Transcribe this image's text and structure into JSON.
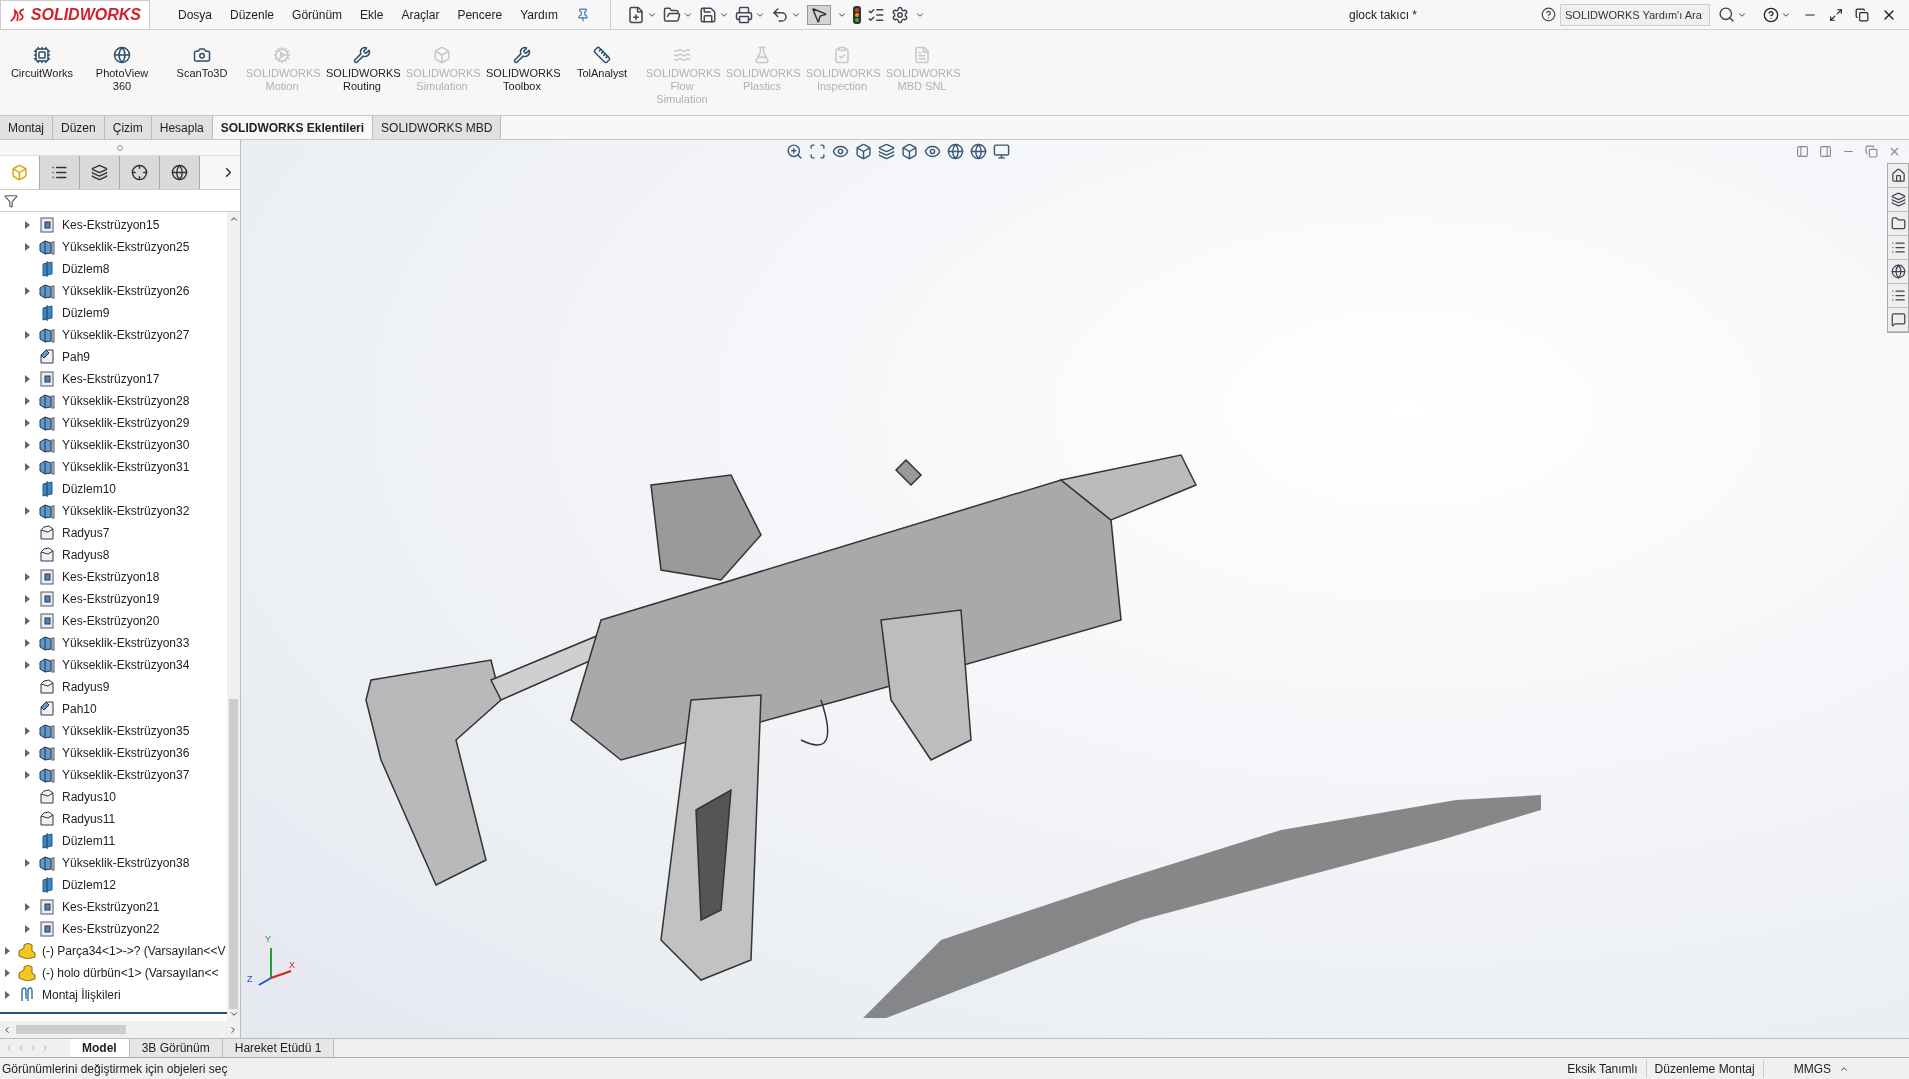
{
  "app": {
    "logo": "SOLIDWORKS",
    "title": "glock takıcı *",
    "search": {
      "placeholder": "SOLIDWORKS Yardım'ı Ara"
    }
  },
  "menu": [
    "Dosya",
    "Düzenle",
    "Görünüm",
    "Ekle",
    "Araçlar",
    "Pencere",
    "Yardım"
  ],
  "ribbon": [
    {
      "label": "CircuitWorks",
      "disabled": false
    },
    {
      "label": "PhotoView 360",
      "disabled": false
    },
    {
      "label": "ScanTo3D",
      "disabled": false
    },
    {
      "label": "SOLIDWORKS Motion",
      "disabled": true
    },
    {
      "label": "SOLIDWORKS Routing",
      "disabled": false
    },
    {
      "label": "SOLIDWORKS Simulation",
      "disabled": true
    },
    {
      "label": "SOLIDWORKS Toolbox",
      "disabled": false
    },
    {
      "label": "TolAnalyst",
      "disabled": false
    },
    {
      "label": "SOLIDWORKS Flow Simulation",
      "disabled": true
    },
    {
      "label": "SOLIDWORKS Plastics",
      "disabled": true
    },
    {
      "label": "SOLIDWORKS Inspection",
      "disabled": true
    },
    {
      "label": "SOLIDWORKS MBD SNL",
      "disabled": true
    }
  ],
  "tabs": [
    {
      "label": "Montaj",
      "selected": false
    },
    {
      "label": "Düzen",
      "selected": false
    },
    {
      "label": "Çizim",
      "selected": false
    },
    {
      "label": "Hesapla",
      "selected": false
    },
    {
      "label": "SOLIDWORKS Eklentileri",
      "selected": true
    },
    {
      "label": "SOLIDWORKS MBD",
      "selected": false
    }
  ],
  "panel_tabs": [
    {
      "selected": true
    },
    {
      "selected": false
    },
    {
      "selected": false
    },
    {
      "selected": false
    },
    {
      "selected": false
    }
  ],
  "tree": {
    "features": [
      {
        "label": "Kes-Ekstrüzyon15",
        "kind": "cut",
        "expandable": true
      },
      {
        "label": "Yükseklik-Ekstrüzyon25",
        "kind": "boss",
        "expandable": true
      },
      {
        "label": "Düzlem8",
        "kind": "plane",
        "expandable": false
      },
      {
        "label": "Yükseklik-Ekstrüzyon26",
        "kind": "boss",
        "expandable": true
      },
      {
        "label": "Düzlem9",
        "kind": "plane",
        "expandable": false
      },
      {
        "label": "Yükseklik-Ekstrüzyon27",
        "kind": "boss",
        "expandable": true
      },
      {
        "label": "Pah9",
        "kind": "chamfer",
        "expandable": false
      },
      {
        "label": "Kes-Ekstrüzyon17",
        "kind": "cut",
        "expandable": true
      },
      {
        "label": "Yükseklik-Ekstrüzyon28",
        "kind": "boss",
        "expandable": true
      },
      {
        "label": "Yükseklik-Ekstrüzyon29",
        "kind": "boss",
        "expandable": true
      },
      {
        "label": "Yükseklik-Ekstrüzyon30",
        "kind": "boss",
        "expandable": true
      },
      {
        "label": "Yükseklik-Ekstrüzyon31",
        "kind": "boss",
        "expandable": true
      },
      {
        "label": "Düzlem10",
        "kind": "plane",
        "expandable": false
      },
      {
        "label": "Yükseklik-Ekstrüzyon32",
        "kind": "boss",
        "expandable": true
      },
      {
        "label": "Radyus7",
        "kind": "fillet",
        "expandable": false
      },
      {
        "label": "Radyus8",
        "kind": "fillet",
        "expandable": false
      },
      {
        "label": "Kes-Ekstrüzyon18",
        "kind": "cut",
        "expandable": true
      },
      {
        "label": "Kes-Ekstrüzyon19",
        "kind": "cut",
        "expandable": true
      },
      {
        "label": "Kes-Ekstrüzyon20",
        "kind": "cut",
        "expandable": true
      },
      {
        "label": "Yükseklik-Ekstrüzyon33",
        "kind": "boss",
        "expandable": true
      },
      {
        "label": "Yükseklik-Ekstrüzyon34",
        "kind": "boss",
        "expandable": true
      },
      {
        "label": "Radyus9",
        "kind": "fillet",
        "expandable": false
      },
      {
        "label": "Pah10",
        "kind": "chamfer",
        "expandable": false
      },
      {
        "label": "Yükseklik-Ekstrüzyon35",
        "kind": "boss",
        "expandable": true
      },
      {
        "label": "Yükseklik-Ekstrüzyon36",
        "kind": "boss",
        "expandable": true
      },
      {
        "label": "Yükseklik-Ekstrüzyon37",
        "kind": "boss",
        "expandable": true
      },
      {
        "label": "Radyus10",
        "kind": "fillet",
        "expandable": false
      },
      {
        "label": "Radyus11",
        "kind": "fillet",
        "expandable": false
      },
      {
        "label": "Düzlem11",
        "kind": "plane",
        "expandable": false
      },
      {
        "label": "Yükseklik-Ekstrüzyon38",
        "kind": "boss",
        "expandable": true
      },
      {
        "label": "Düzlem12",
        "kind": "plane",
        "expandable": false
      },
      {
        "label": "Kes-Ekstrüzyon21",
        "kind": "cut",
        "expandable": true
      },
      {
        "label": "Kes-Ekstrüzyon22",
        "kind": "cut",
        "expandable": true
      }
    ],
    "components": [
      {
        "label": "(-) Parça34<1>->? (Varsayılan<<V",
        "kind": "part",
        "expandable": true
      },
      {
        "label": "(-) holo dürbün<1> (Varsayılan<<",
        "kind": "part",
        "expandable": true
      },
      {
        "label": "Montaj İlişkileri",
        "kind": "mates",
        "expandable": true
      }
    ]
  },
  "triad": {
    "x": "X",
    "y": "Y",
    "z": "Z"
  },
  "bottom_tabs": [
    {
      "label": "Model",
      "selected": true
    },
    {
      "label": "3B Görünüm",
      "selected": false
    },
    {
      "label": "Hareket Etüdü 1",
      "selected": false
    }
  ],
  "status_bar": {
    "message": "Görünümlerini değiştirmek için objeleri seç",
    "definition": "Eksik Tanımlı",
    "mode": "Düzenleme Montaj",
    "units": "MMGS"
  }
}
